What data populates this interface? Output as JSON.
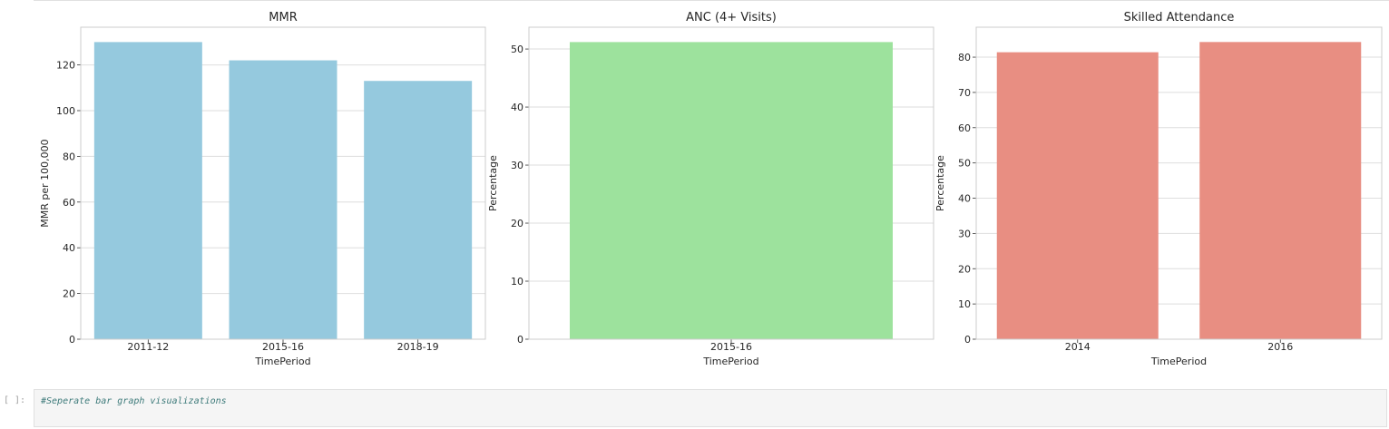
{
  "chart_data": [
    {
      "type": "bar",
      "title": "MMR",
      "xlabel": "TimePeriod",
      "ylabel": "MMR per 100,000",
      "categories": [
        "2011-12",
        "2015-16",
        "2018-19"
      ],
      "values": [
        130,
        122,
        113
      ],
      "ylim": [
        0,
        136.5
      ],
      "yticks": [
        0,
        20,
        40,
        60,
        80,
        100,
        120
      ],
      "color": "#95c9de",
      "grid": true
    },
    {
      "type": "bar",
      "title": "ANC (4+ Visits)",
      "xlabel": "TimePeriod",
      "ylabel": "Percentage",
      "categories": [
        "2015-16"
      ],
      "values": [
        51.2
      ],
      "ylim": [
        0,
        53.76
      ],
      "yticks": [
        0,
        10,
        20,
        30,
        40,
        50
      ],
      "color": "#9de29d",
      "grid": true
    },
    {
      "type": "bar",
      "title": "Skilled Attendance",
      "xlabel": "TimePeriod",
      "ylabel": "Percentage",
      "categories": [
        "2014",
        "2016"
      ],
      "values": [
        81.4,
        84.3
      ],
      "ylim": [
        0,
        88.5
      ],
      "yticks": [
        0,
        10,
        20,
        30,
        40,
        50,
        60,
        70,
        80
      ],
      "color": "#e88e82",
      "grid": true
    }
  ],
  "notebook": {
    "prompt": "[ ]:",
    "code": "#Seperate bar graph visualizations"
  }
}
